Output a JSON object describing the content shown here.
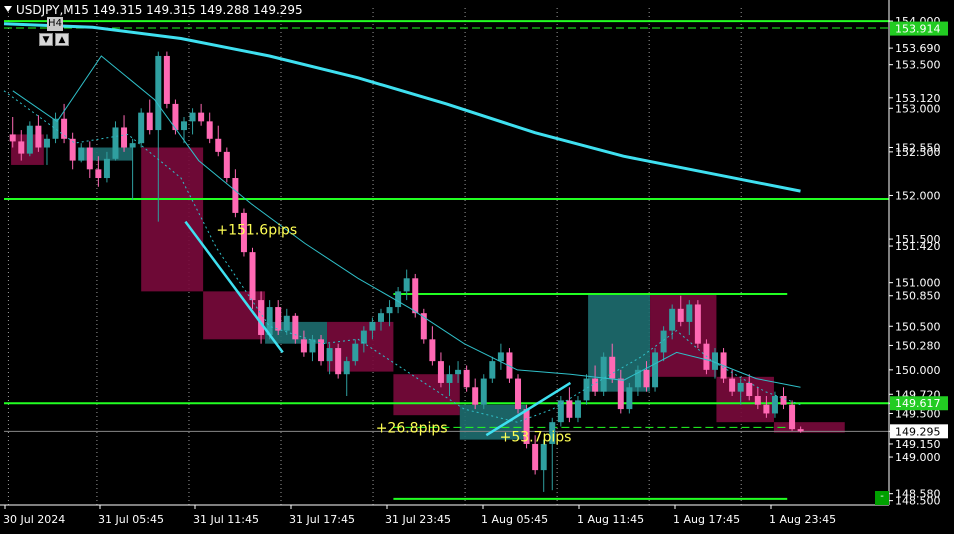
{
  "header": {
    "symbol_line": "USDJPY,M15  149.315 149.315 149.288 149.295"
  },
  "timeframe_panel": {
    "label": "H4",
    "down_icon": "triangle-down-icon",
    "up_icon": "triangle-up-icon"
  },
  "colors": {
    "background": "#000000",
    "bull_candle": "#2f9fa0",
    "bear_candle": "#ff69b4",
    "box_bear": "#7a0a3c",
    "box_bull": "#1e6e70",
    "ma_slow": "#3fe0f0",
    "ma_fast": "#2fbfc8",
    "levels": "#22ff22",
    "annotation_text": "#ffff55",
    "price_tag_green": "#22cc22",
    "price_tag_white": "#ffffff"
  },
  "chart_data": {
    "type": "candlestick",
    "symbol": "USDJPY",
    "timeframe": "M15",
    "ylim": [
      148.45,
      154.15
    ],
    "x_ticks": [
      "30 Jul 2024",
      "31 Jul 05:45",
      "31 Jul 11:45",
      "31 Jul 17:45",
      "31 Jul 23:45",
      "1 Aug 05:45",
      "1 Aug 11:45",
      "1 Aug 17:45",
      "1 Aug 23:45"
    ],
    "y_ticks": [
      154.0,
      153.69,
      153.5,
      153.12,
      153.0,
      152.55,
      152.5,
      152.0,
      151.5,
      151.42,
      151.0,
      150.85,
      150.5,
      150.28,
      150.0,
      149.72,
      149.617,
      149.5,
      149.295,
      149.15,
      149.0,
      148.58,
      148.5
    ],
    "y_tick_labels": [
      "154.000",
      "153.690",
      "153.500",
      "153.120",
      "153.000",
      "152.550",
      "152.500",
      "152.000",
      "151.500",
      "151.420",
      "151.000",
      "150.850",
      "150.500",
      "150.280",
      "150.000",
      "149.720",
      "149.617",
      "149.500",
      "149.295",
      "149.150",
      "149.000",
      "148.580",
      "148.500"
    ],
    "price_tags": {
      "green_top": "153.914",
      "green_ma": "149.617",
      "last_price": "149.295",
      "bottom_level": "148.500"
    },
    "horizontal_levels": [
      {
        "price": 154.0,
        "style": "solid",
        "span": "full"
      },
      {
        "price": 153.92,
        "style": "dashed",
        "span": "full"
      },
      {
        "price": 151.96,
        "style": "solid",
        "span": "full"
      },
      {
        "price": 150.87,
        "style": "solid",
        "span": "right"
      },
      {
        "price": 149.617,
        "style": "solid",
        "span": "full"
      },
      {
        "price": 149.34,
        "style": "dashed",
        "span": "right"
      },
      {
        "price": 148.52,
        "style": "solid",
        "span": "right"
      }
    ],
    "annotations": [
      {
        "text": "+151.6pips",
        "price": 151.55,
        "x_frac": 0.24
      },
      {
        "text": "+26.8pips",
        "price": 149.28,
        "x_frac": 0.42
      },
      {
        "text": "+53.7pips",
        "price": 149.18,
        "x_frac": 0.56
      }
    ],
    "candles": [
      {
        "o": 152.7,
        "h": 152.9,
        "l": 152.55,
        "c": 152.62
      },
      {
        "o": 152.62,
        "h": 152.75,
        "l": 152.4,
        "c": 152.48
      },
      {
        "o": 152.48,
        "h": 152.85,
        "l": 152.45,
        "c": 152.8
      },
      {
        "o": 152.8,
        "h": 152.92,
        "l": 152.5,
        "c": 152.55
      },
      {
        "o": 152.55,
        "h": 152.7,
        "l": 152.35,
        "c": 152.65
      },
      {
        "o": 152.65,
        "h": 152.95,
        "l": 152.6,
        "c": 152.88
      },
      {
        "o": 152.88,
        "h": 153.05,
        "l": 152.6,
        "c": 152.65
      },
      {
        "o": 152.65,
        "h": 152.72,
        "l": 152.3,
        "c": 152.4
      },
      {
        "o": 152.4,
        "h": 152.6,
        "l": 152.38,
        "c": 152.55
      },
      {
        "o": 152.55,
        "h": 152.62,
        "l": 152.2,
        "c": 152.3
      },
      {
        "o": 152.3,
        "h": 152.45,
        "l": 152.1,
        "c": 152.2
      },
      {
        "o": 152.2,
        "h": 152.5,
        "l": 152.15,
        "c": 152.42
      },
      {
        "o": 152.42,
        "h": 152.85,
        "l": 152.4,
        "c": 152.78
      },
      {
        "o": 152.78,
        "h": 152.92,
        "l": 152.5,
        "c": 152.55
      },
      {
        "o": 152.55,
        "h": 152.65,
        "l": 151.95,
        "c": 152.6
      },
      {
        "o": 152.6,
        "h": 153.0,
        "l": 152.55,
        "c": 152.95
      },
      {
        "o": 152.95,
        "h": 153.1,
        "l": 152.7,
        "c": 152.75
      },
      {
        "o": 152.75,
        "h": 153.65,
        "l": 151.7,
        "c": 153.6
      },
      {
        "o": 153.6,
        "h": 153.65,
        "l": 153.0,
        "c": 153.05
      },
      {
        "o": 153.05,
        "h": 153.1,
        "l": 152.7,
        "c": 152.75
      },
      {
        "o": 152.75,
        "h": 152.9,
        "l": 152.6,
        "c": 152.85
      },
      {
        "o": 152.85,
        "h": 153.0,
        "l": 152.7,
        "c": 152.95
      },
      {
        "o": 152.95,
        "h": 153.05,
        "l": 152.8,
        "c": 152.85
      },
      {
        "o": 152.85,
        "h": 152.95,
        "l": 152.6,
        "c": 152.65
      },
      {
        "o": 152.65,
        "h": 152.8,
        "l": 152.45,
        "c": 152.5
      },
      {
        "o": 152.5,
        "h": 152.55,
        "l": 152.15,
        "c": 152.2
      },
      {
        "o": 152.2,
        "h": 152.3,
        "l": 151.75,
        "c": 151.8
      },
      {
        "o": 151.8,
        "h": 151.85,
        "l": 151.3,
        "c": 151.35
      },
      {
        "o": 151.35,
        "h": 151.4,
        "l": 150.7,
        "c": 150.8
      },
      {
        "o": 150.8,
        "h": 150.9,
        "l": 150.3,
        "c": 150.4
      },
      {
        "o": 150.4,
        "h": 150.8,
        "l": 150.35,
        "c": 150.72
      },
      {
        "o": 150.72,
        "h": 150.8,
        "l": 150.4,
        "c": 150.45
      },
      {
        "o": 150.45,
        "h": 150.7,
        "l": 150.4,
        "c": 150.62
      },
      {
        "o": 150.62,
        "h": 150.65,
        "l": 150.3,
        "c": 150.35
      },
      {
        "o": 150.35,
        "h": 150.45,
        "l": 150.15,
        "c": 150.2
      },
      {
        "o": 150.2,
        "h": 150.4,
        "l": 150.1,
        "c": 150.35
      },
      {
        "o": 150.35,
        "h": 150.4,
        "l": 150.05,
        "c": 150.1
      },
      {
        "o": 150.1,
        "h": 150.3,
        "l": 149.95,
        "c": 150.25
      },
      {
        "o": 150.25,
        "h": 150.3,
        "l": 149.9,
        "c": 149.95
      },
      {
        "o": 149.95,
        "h": 150.15,
        "l": 149.7,
        "c": 150.1
      },
      {
        "o": 150.1,
        "h": 150.35,
        "l": 150.05,
        "c": 150.3
      },
      {
        "o": 150.3,
        "h": 150.5,
        "l": 150.2,
        "c": 150.45
      },
      {
        "o": 150.45,
        "h": 150.6,
        "l": 150.35,
        "c": 150.55
      },
      {
        "o": 150.55,
        "h": 150.7,
        "l": 150.45,
        "c": 150.65
      },
      {
        "o": 150.65,
        "h": 150.8,
        "l": 150.5,
        "c": 150.72
      },
      {
        "o": 150.72,
        "h": 150.95,
        "l": 150.65,
        "c": 150.9
      },
      {
        "o": 150.9,
        "h": 151.15,
        "l": 150.8,
        "c": 151.05
      },
      {
        "o": 151.05,
        "h": 151.1,
        "l": 150.6,
        "c": 150.65
      },
      {
        "o": 150.65,
        "h": 150.7,
        "l": 150.3,
        "c": 150.35
      },
      {
        "o": 150.35,
        "h": 150.5,
        "l": 150.05,
        "c": 150.1
      },
      {
        "o": 150.1,
        "h": 150.2,
        "l": 149.8,
        "c": 149.85
      },
      {
        "o": 149.85,
        "h": 150.05,
        "l": 149.7,
        "c": 149.95
      },
      {
        "o": 149.95,
        "h": 150.1,
        "l": 149.85,
        "c": 150.0
      },
      {
        "o": 150.0,
        "h": 150.05,
        "l": 149.75,
        "c": 149.8
      },
      {
        "o": 149.8,
        "h": 149.9,
        "l": 149.55,
        "c": 149.6
      },
      {
        "o": 149.6,
        "h": 149.95,
        "l": 149.55,
        "c": 149.9
      },
      {
        "o": 149.9,
        "h": 150.15,
        "l": 149.85,
        "c": 150.1
      },
      {
        "o": 150.1,
        "h": 150.3,
        "l": 150.0,
        "c": 150.2
      },
      {
        "o": 150.2,
        "h": 150.25,
        "l": 149.85,
        "c": 149.9
      },
      {
        "o": 149.9,
        "h": 149.95,
        "l": 149.5,
        "c": 149.55
      },
      {
        "o": 149.55,
        "h": 149.6,
        "l": 149.1,
        "c": 149.15
      },
      {
        "o": 149.15,
        "h": 149.25,
        "l": 148.8,
        "c": 148.85
      },
      {
        "o": 148.85,
        "h": 149.2,
        "l": 148.6,
        "c": 149.15
      },
      {
        "o": 149.15,
        "h": 149.45,
        "l": 148.62,
        "c": 149.4
      },
      {
        "o": 149.4,
        "h": 149.7,
        "l": 149.35,
        "c": 149.65
      },
      {
        "o": 149.65,
        "h": 149.8,
        "l": 149.4,
        "c": 149.45
      },
      {
        "o": 149.45,
        "h": 149.7,
        "l": 149.4,
        "c": 149.65
      },
      {
        "o": 149.65,
        "h": 149.95,
        "l": 149.6,
        "c": 149.9
      },
      {
        "o": 149.9,
        "h": 150.05,
        "l": 149.7,
        "c": 149.75
      },
      {
        "o": 149.75,
        "h": 150.2,
        "l": 149.7,
        "c": 150.15
      },
      {
        "o": 150.15,
        "h": 150.3,
        "l": 149.85,
        "c": 149.9
      },
      {
        "o": 149.9,
        "h": 150.0,
        "l": 149.5,
        "c": 149.55
      },
      {
        "o": 149.55,
        "h": 149.85,
        "l": 149.5,
        "c": 149.8
      },
      {
        "o": 149.8,
        "h": 150.05,
        "l": 149.7,
        "c": 150.0
      },
      {
        "o": 150.0,
        "h": 150.1,
        "l": 149.75,
        "c": 149.8
      },
      {
        "o": 149.8,
        "h": 150.25,
        "l": 149.75,
        "c": 150.2
      },
      {
        "o": 150.2,
        "h": 150.5,
        "l": 150.1,
        "c": 150.45
      },
      {
        "o": 150.45,
        "h": 150.75,
        "l": 150.35,
        "c": 150.7
      },
      {
        "o": 150.7,
        "h": 150.85,
        "l": 150.5,
        "c": 150.55
      },
      {
        "o": 150.55,
        "h": 150.8,
        "l": 150.4,
        "c": 150.75
      },
      {
        "o": 150.75,
        "h": 150.8,
        "l": 150.25,
        "c": 150.3
      },
      {
        "o": 150.3,
        "h": 150.35,
        "l": 149.95,
        "c": 150.0
      },
      {
        "o": 150.0,
        "h": 150.25,
        "l": 149.9,
        "c": 150.2
      },
      {
        "o": 150.2,
        "h": 150.25,
        "l": 149.85,
        "c": 149.9
      },
      {
        "o": 149.9,
        "h": 150.0,
        "l": 149.7,
        "c": 149.75
      },
      {
        "o": 149.75,
        "h": 149.9,
        "l": 149.6,
        "c": 149.85
      },
      {
        "o": 149.85,
        "h": 149.95,
        "l": 149.65,
        "c": 149.7
      },
      {
        "o": 149.7,
        "h": 149.8,
        "l": 149.55,
        "c": 149.6
      },
      {
        "o": 149.6,
        "h": 149.7,
        "l": 149.45,
        "c": 149.5
      },
      {
        "o": 149.5,
        "h": 149.75,
        "l": 149.45,
        "c": 149.7
      },
      {
        "o": 149.7,
        "h": 149.8,
        "l": 149.55,
        "c": 149.6
      },
      {
        "o": 149.6,
        "h": 149.65,
        "l": 149.3,
        "c": 149.32
      },
      {
        "o": 149.32,
        "h": 149.35,
        "l": 149.28,
        "c": 149.295
      }
    ],
    "ma_slow": {
      "name": "",
      "points": [
        [
          0,
          153.97
        ],
        [
          0.1,
          153.93
        ],
        [
          0.2,
          153.8
        ],
        [
          0.3,
          153.6
        ],
        [
          0.4,
          153.35
        ],
        [
          0.5,
          153.05
        ],
        [
          0.6,
          152.72
        ],
        [
          0.7,
          152.45
        ],
        [
          0.8,
          152.25
        ],
        [
          0.9,
          152.05
        ]
      ]
    },
    "ma_fast": {
      "name": "",
      "points": [
        [
          0.01,
          153.2
        ],
        [
          0.06,
          152.85
        ],
        [
          0.11,
          153.6
        ],
        [
          0.17,
          153.1
        ],
        [
          0.22,
          152.4
        ],
        [
          0.28,
          151.9
        ],
        [
          0.34,
          151.45
        ],
        [
          0.4,
          151.05
        ],
        [
          0.46,
          150.7
        ],
        [
          0.52,
          150.3
        ],
        [
          0.58,
          150.0
        ],
        [
          0.64,
          149.95
        ],
        [
          0.7,
          149.88
        ],
        [
          0.76,
          150.2
        ],
        [
          0.8,
          150.1
        ],
        [
          0.85,
          149.9
        ],
        [
          0.9,
          149.8
        ]
      ]
    },
    "ma_short_dotted": {
      "name": "",
      "points": [
        [
          0.0,
          153.2
        ],
        [
          0.08,
          152.6
        ],
        [
          0.14,
          152.7
        ],
        [
          0.2,
          152.2
        ],
        [
          0.24,
          151.4
        ],
        [
          0.3,
          150.5
        ],
        [
          0.36,
          150.3
        ],
        [
          0.4,
          150.35
        ],
        [
          0.46,
          149.95
        ],
        [
          0.52,
          149.55
        ],
        [
          0.58,
          149.4
        ],
        [
          0.62,
          149.55
        ],
        [
          0.66,
          149.8
        ],
        [
          0.72,
          150.15
        ],
        [
          0.76,
          150.45
        ],
        [
          0.8,
          150.1
        ],
        [
          0.86,
          149.75
        ],
        [
          0.9,
          149.6
        ]
      ]
    },
    "boxes": [
      {
        "x0": 0.008,
        "x1": 0.045,
        "y0": 152.7,
        "y1": 152.35,
        "kind": "bear"
      },
      {
        "x0": 0.085,
        "x1": 0.145,
        "y0": 152.55,
        "y1": 152.4,
        "kind": "bull"
      },
      {
        "x0": 0.155,
        "x1": 0.225,
        "y0": 152.55,
        "y1": 150.9,
        "kind": "bear"
      },
      {
        "x0": 0.225,
        "x1": 0.295,
        "y0": 150.9,
        "y1": 150.35,
        "kind": "bear"
      },
      {
        "x0": 0.295,
        "x1": 0.365,
        "y0": 150.55,
        "y1": 150.3,
        "kind": "bull"
      },
      {
        "x0": 0.365,
        "x1": 0.44,
        "y0": 150.55,
        "y1": 149.98,
        "kind": "bear"
      },
      {
        "x0": 0.44,
        "x1": 0.515,
        "y0": 149.95,
        "y1": 149.48,
        "kind": "bear"
      },
      {
        "x0": 0.515,
        "x1": 0.59,
        "y0": 149.6,
        "y1": 149.2,
        "kind": "bull"
      },
      {
        "x0": 0.66,
        "x1": 0.73,
        "y0": 150.87,
        "y1": 149.75,
        "kind": "bull"
      },
      {
        "x0": 0.73,
        "x1": 0.805,
        "y0": 150.87,
        "y1": 149.92,
        "kind": "bear"
      },
      {
        "x0": 0.805,
        "x1": 0.87,
        "y0": 149.92,
        "y1": 149.4,
        "kind": "bear"
      },
      {
        "x0": 0.87,
        "x1": 0.95,
        "y0": 149.4,
        "y1": 149.28,
        "kind": "bear"
      }
    ],
    "trend_segments": [
      {
        "x0": 0.205,
        "y0": 151.7,
        "x1": 0.315,
        "y1": 150.2
      },
      {
        "x0": 0.545,
        "y0": 149.25,
        "x1": 0.64,
        "y1": 149.85
      }
    ]
  }
}
